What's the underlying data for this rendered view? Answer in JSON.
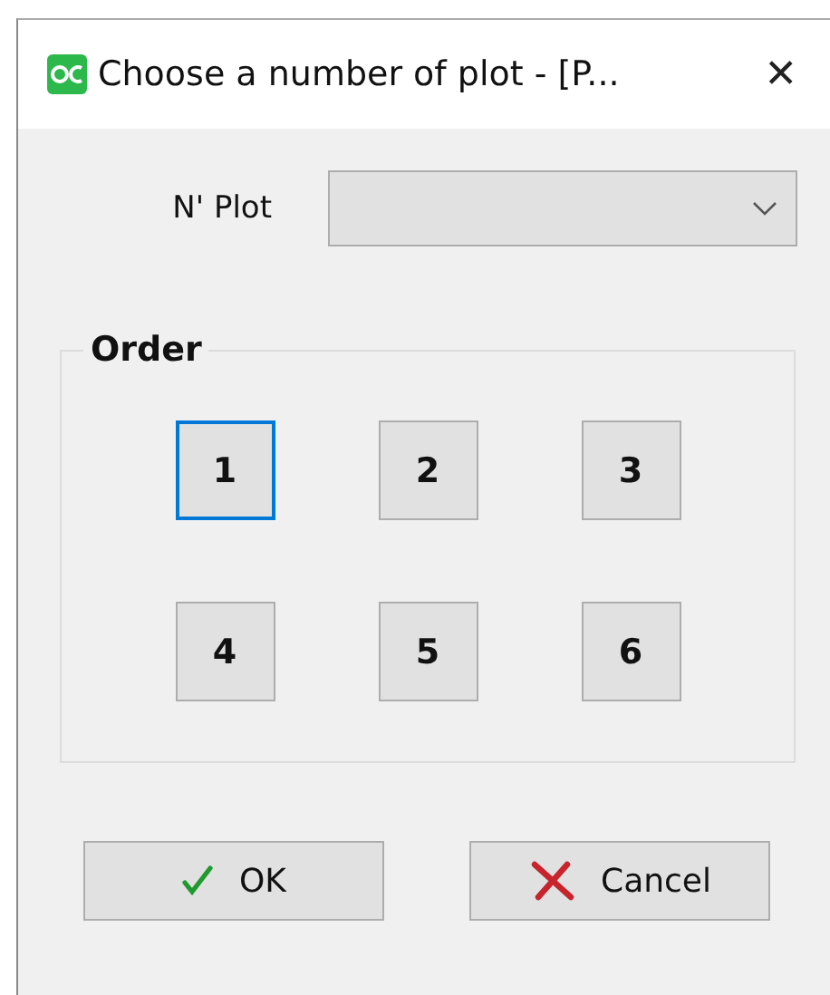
{
  "window": {
    "title": "Choose a number of plot - [P...",
    "close": "✕"
  },
  "plot_field": {
    "label": "N' Plot"
  },
  "order": {
    "title": "Order",
    "buttons": [
      {
        "label": "1",
        "selected": true
      },
      {
        "label": "2",
        "selected": false
      },
      {
        "label": "3",
        "selected": false
      },
      {
        "label": "4",
        "selected": false
      },
      {
        "label": "5",
        "selected": false
      },
      {
        "label": "6",
        "selected": false
      }
    ]
  },
  "actions": [
    {
      "kind": "ok",
      "label": "OK"
    },
    {
      "kind": "cancel",
      "label": "Cancel"
    }
  ]
}
